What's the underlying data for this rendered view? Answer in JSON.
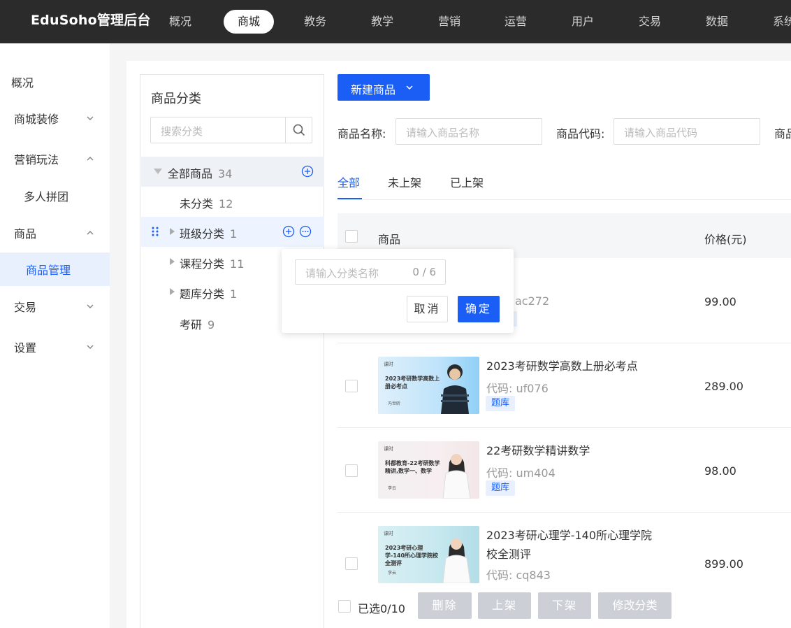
{
  "app": {
    "title": "EduSoho管理后台"
  },
  "topnav": [
    "概况",
    "商城",
    "教务",
    "教学",
    "营销",
    "运营",
    "用户",
    "交易",
    "数据",
    "系统"
  ],
  "sidebar": {
    "items": [
      {
        "label": "概况"
      },
      {
        "label": "商城装修",
        "chevron": "chevron-down-icon"
      },
      {
        "label": "营销玩法",
        "chevron": "chevron-up-icon"
      },
      {
        "label": "多人拼团"
      },
      {
        "label": "商品",
        "chevron": "chevron-up-icon"
      },
      {
        "label": "商品管理"
      },
      {
        "label": "交易",
        "chevron": "chevron-down-icon"
      },
      {
        "label": "设置",
        "chevron": "chevron-down-icon"
      }
    ]
  },
  "category": {
    "title": "商品分类",
    "search_placeholder": "搜索分类",
    "tree": [
      {
        "label": "全部商品",
        "count": "34"
      },
      {
        "label": "未分类",
        "count": "12"
      },
      {
        "label": "班级分类",
        "count": "1"
      },
      {
        "label": "课程分类",
        "count": "11"
      },
      {
        "label": "题库分类",
        "count": "1"
      },
      {
        "label": "考研",
        "count": "9"
      }
    ]
  },
  "popover": {
    "placeholder": "请输入分类名称",
    "counter": "0 / 6",
    "cancel": "取消",
    "confirm": "确定"
  },
  "toolbar": {
    "new_button": "新建商品"
  },
  "filters": {
    "name_label": "商品名称:",
    "name_placeholder": "请输入商品名称",
    "code_label": "商品代码:",
    "code_placeholder": "请输入商品代码",
    "third_label": "商品"
  },
  "tabs": [
    "全部",
    "未上架",
    "已上架"
  ],
  "table": {
    "headers": {
      "product": "商品",
      "price": "价格(元)"
    },
    "rows": [
      {
        "name": "",
        "code": "ac272",
        "tag": "",
        "price": "99.00"
      },
      {
        "name": "2023考研数学高数上册必考点",
        "code": "代码: uf076",
        "tag": "题库",
        "price": "289.00",
        "thumb": {
          "logo": "课时",
          "title": "2023考研数学高数上册必考点",
          "name": "冯世昕"
        }
      },
      {
        "name": "22考研数学精讲数学",
        "code": "代码: um404",
        "tag": "题库",
        "price": "98.00",
        "thumb": {
          "logo": "课时",
          "title": "科都教育-22考研数学精讲,数学一、数学",
          "name": "李云"
        }
      },
      {
        "name": "2023考研心理学-140所心理学院",
        "name2": "校全测评",
        "code": "代码: cq843",
        "tag": "",
        "price": "899.00",
        "thumb": {
          "logo": "课时",
          "title": "2023考研心理学-140所心理学院校全测评",
          "name": "李云"
        }
      }
    ]
  },
  "footer": {
    "selected": "已选0/10",
    "buttons": [
      "删除",
      "上架",
      "下架",
      "修改分类"
    ]
  },
  "colors": {
    "accent": "#1a5ef5",
    "topbar": "#2b2b2b"
  }
}
